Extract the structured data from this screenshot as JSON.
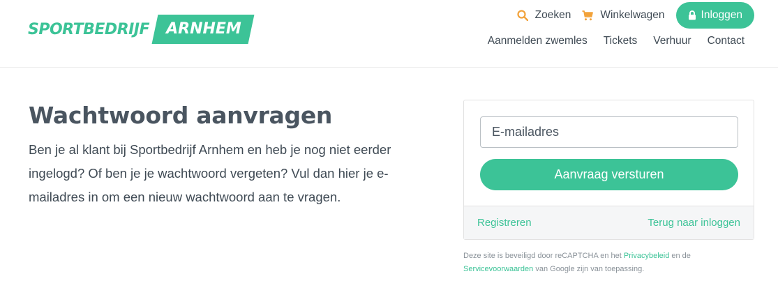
{
  "header": {
    "logo": {
      "part1": "SPORTBEDRIJF",
      "part2": "ARNHEM"
    },
    "search_label": "Zoeken",
    "cart_label": "Winkelwagen",
    "login_label": "Inloggen",
    "nav": [
      "Aanmelden zwemles",
      "Tickets",
      "Verhuur",
      "Contact"
    ]
  },
  "main": {
    "title": "Wachtwoord aanvragen",
    "intro": "Ben je al klant bij Sportbedrijf Arnhem en heb je nog niet eerder ingelogd? Of ben je je wachtwoord vergeten? Vul dan hier je e-mailadres in om een nieuw wachtwoord aan te vragen."
  },
  "form": {
    "email_placeholder": "E-mailadres",
    "email_value": "",
    "submit_label": "Aanvraag versturen",
    "register_label": "Registreren",
    "back_label": "Terug naar inloggen"
  },
  "recaptcha": {
    "text1": "Deze site is beveiligd door reCAPTCHA en het",
    "privacy": "Privacybeleid",
    "text2": "en de",
    "terms": "Servicevoorwaarden",
    "text3": "van Google zijn van toepassing."
  },
  "colors": {
    "accent": "#3cc397",
    "text": "#3f4a54",
    "icon_orange": "#f2a23a"
  },
  "icons": {
    "search": "search-icon",
    "cart": "cart-icon",
    "lock": "lock-icon"
  }
}
